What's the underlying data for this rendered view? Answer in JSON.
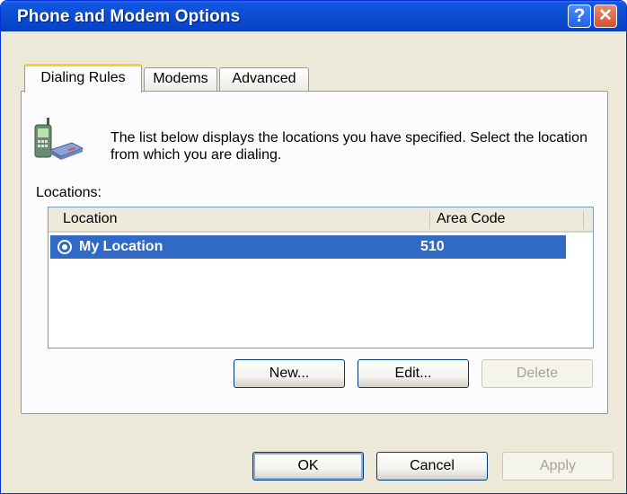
{
  "window": {
    "title": "Phone and Modem Options",
    "help_glyph": "?",
    "close_glyph": "✕"
  },
  "tabs": [
    {
      "label": "Dialing Rules",
      "active": true
    },
    {
      "label": "Modems",
      "active": false
    },
    {
      "label": "Advanced",
      "active": false
    }
  ],
  "dialing_rules": {
    "intro_text": "The list below displays the locations you have specified. Select the location from which you are dialing.",
    "locations_label": "Locations:",
    "columns": [
      "Location",
      "Area Code"
    ],
    "rows": [
      {
        "location": "My Location",
        "area_code": "510",
        "selected": true,
        "icon": "location-radio-icon"
      }
    ],
    "buttons": {
      "new": "New...",
      "edit": "Edit...",
      "delete": "Delete"
    }
  },
  "footer": {
    "ok": "OK",
    "cancel": "Cancel",
    "apply": "Apply"
  },
  "colors": {
    "title_bar": "#0a4fd6",
    "selection": "#316ac5",
    "dialog_bg": "#ece9d8",
    "tab_highlight": "#ffc83c"
  },
  "icons": {
    "header_icon": "phone-modem-icon",
    "help": "help-icon",
    "close": "close-icon"
  }
}
